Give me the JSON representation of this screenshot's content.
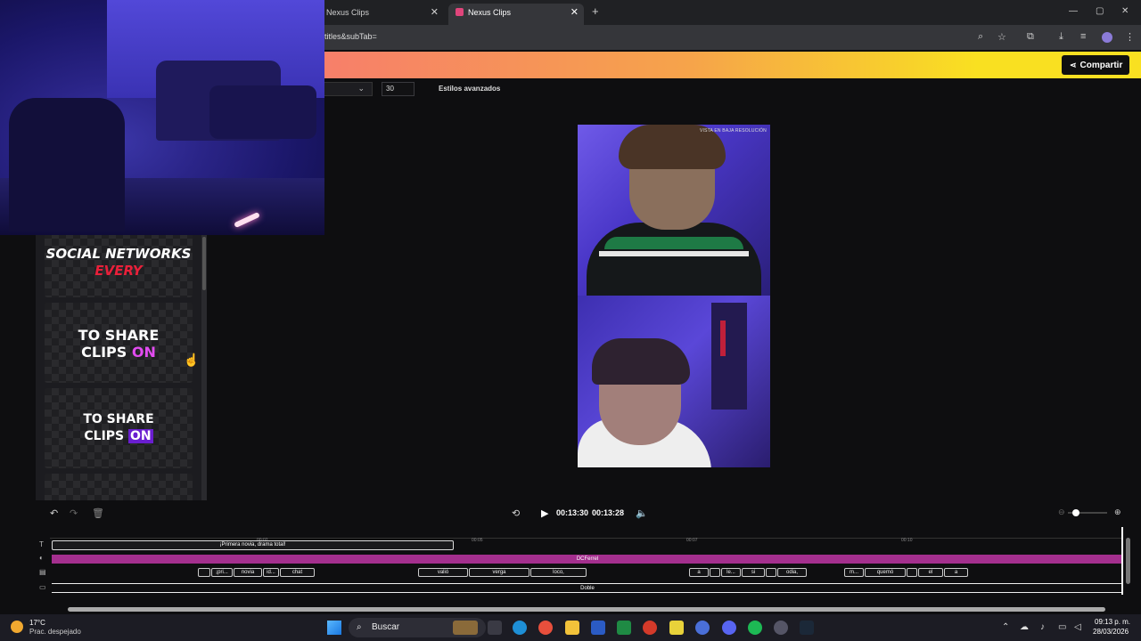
{
  "browser": {
    "tabs": [
      {
        "label": "Nexus Clips",
        "active": false
      },
      {
        "label": "Nexus Clips",
        "active": true
      }
    ],
    "url": "titles&subTab=",
    "new_tab": "+",
    "close_glyph": "✕",
    "window_controls": [
      "—",
      "▢",
      "✕"
    ]
  },
  "header": {
    "share_label": "Compartir",
    "share_icon": "share-icon"
  },
  "toolbar": {
    "font_size_value": "30",
    "advanced_styles_label": "Estilos avanzados"
  },
  "subtitle_panel": {
    "cards": [
      {
        "line1": "SOCIAL NETWORKS",
        "line2": "EVERY"
      },
      {
        "line1": "TO SHARE",
        "line2_a": "CLIPS ",
        "line2_b": "ON"
      },
      {
        "line1": "TO SHARE",
        "line2_a": "CLIPS ",
        "line2_b": "ON"
      }
    ]
  },
  "preview": {
    "watermark": "VISTA EN BAJA RESOLUCIÓN"
  },
  "playback": {
    "current_time": "00:13:30",
    "total_time": "00:13:28",
    "zoom_level": 0.2
  },
  "timeline": {
    "ruler_ticks": [
      "00:02",
      "00:05",
      "00:07",
      "00:10"
    ],
    "title_clip": "¡Primera novia, drama total!",
    "pink_clip": "DCFerrel",
    "words": [
      "¡pri...",
      "novia",
      "id...",
      "chat",
      "valió",
      "verga",
      "loco,",
      "a",
      "le...",
      "si",
      "odia,",
      "m...",
      "quemó",
      "el",
      "a"
    ],
    "bottom_clip": "Doble"
  },
  "taskbar": {
    "weather_temp": "17°C",
    "weather_desc": "Prac. despejado",
    "search_label": "Buscar",
    "clock_time": "09:13 p. m.",
    "clock_date": "28/03/2026"
  },
  "colors": {
    "accent_pink": "#a42f8e",
    "gradient_start": "#f77f6a",
    "gradient_end": "#f9e021"
  }
}
